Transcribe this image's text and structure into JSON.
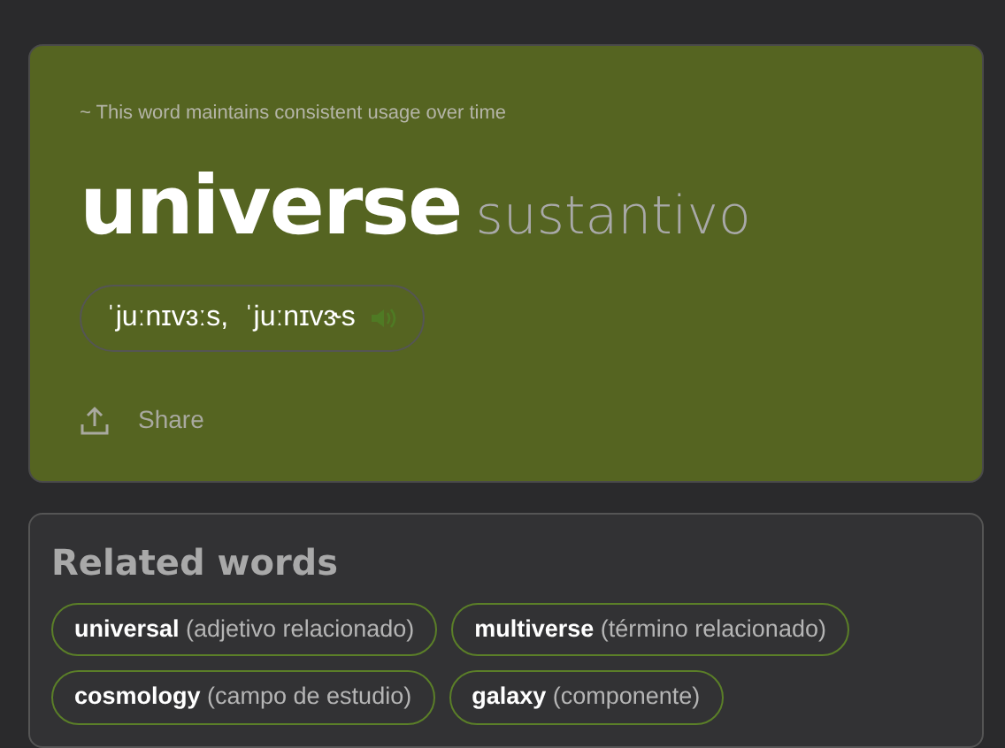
{
  "trend_note": "~ This word maintains consistent usage over time",
  "word": "universe",
  "part_of_speech": "sustantivo",
  "pronunciation": "ˈjuːnɪvɜːs,  ˈjuːnɪvɝs",
  "share_label": "Share",
  "related": {
    "title": "Related words",
    "items": [
      {
        "word": "universal",
        "note": "(adjetivo relacionado)"
      },
      {
        "word": "multiverse",
        "note": "(término relacionado)"
      },
      {
        "word": "cosmology",
        "note": "(campo de estudio)"
      },
      {
        "word": "galaxy",
        "note": "(componente)"
      }
    ]
  }
}
